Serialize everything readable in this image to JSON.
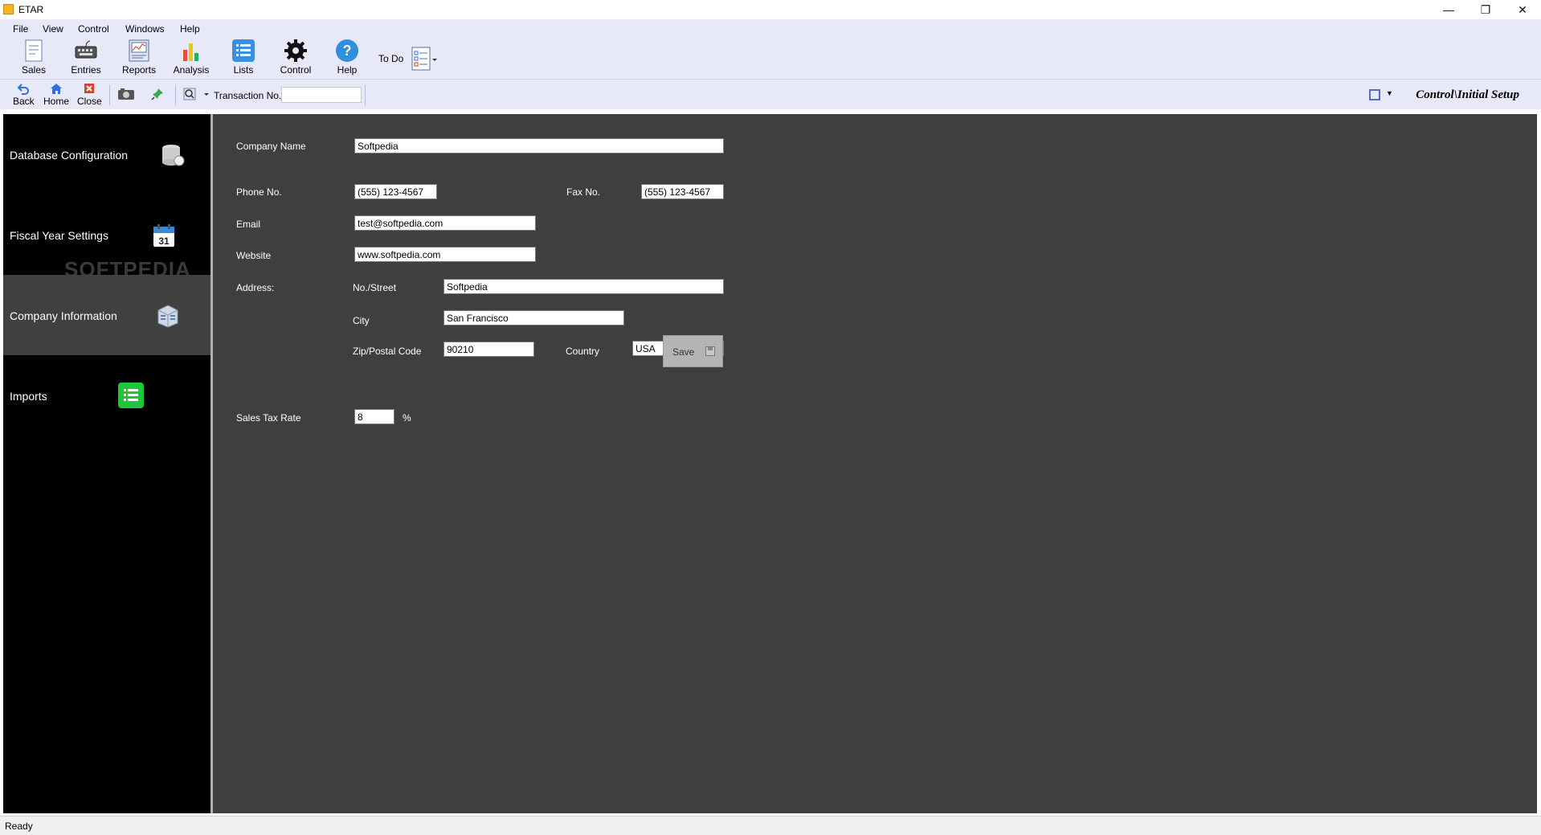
{
  "window": {
    "title": "ETAR"
  },
  "menu": [
    "File",
    "View",
    "Control",
    "Windows",
    "Help"
  ],
  "ribbon": {
    "sales": "Sales",
    "entries": "Entries",
    "reports": "Reports",
    "analysis": "Analysis",
    "lists": "Lists",
    "control": "Control",
    "help": "Help",
    "todo": "To Do"
  },
  "toolbar": {
    "back": "Back",
    "home": "Home",
    "close": "Close",
    "transaction_label": "Transaction No.",
    "transaction_value": "",
    "breadcrumb": "Control\\Initial Setup"
  },
  "sidebar": {
    "items": [
      {
        "label": "Database Configuration"
      },
      {
        "label": "Fiscal Year Settings",
        "calendar_day": "31"
      },
      {
        "label": "Company Information",
        "active": true
      },
      {
        "label": "Imports"
      }
    ],
    "watermark": "SOFTPEDIA"
  },
  "form": {
    "company_name_label": "Company Name",
    "company_name": "Softpedia",
    "phone_label": "Phone No.",
    "phone": "(555) 123-4567",
    "fax_label": "Fax No.",
    "fax": "(555) 123-4567",
    "email_label": "Email",
    "email": "test@softpedia.com",
    "website_label": "Website",
    "website": "www.softpedia.com",
    "address_label": "Address:",
    "street_label": "No./Street",
    "street": "Softpedia",
    "city_label": "City",
    "city": "San Francisco",
    "zip_label": "Zip/Postal Code",
    "zip": "90210",
    "country_label": "Country",
    "country": "USA",
    "tax_label": "Sales Tax Rate",
    "tax_rate": "8",
    "tax_unit": "%",
    "save_label": "Save"
  },
  "status": {
    "text": "Ready"
  },
  "colors": {
    "sidebar_bg": "#000000",
    "content_bg": "#3f3f3f",
    "active_item": "#404040",
    "chrome_bg": "#e7e8f8"
  }
}
